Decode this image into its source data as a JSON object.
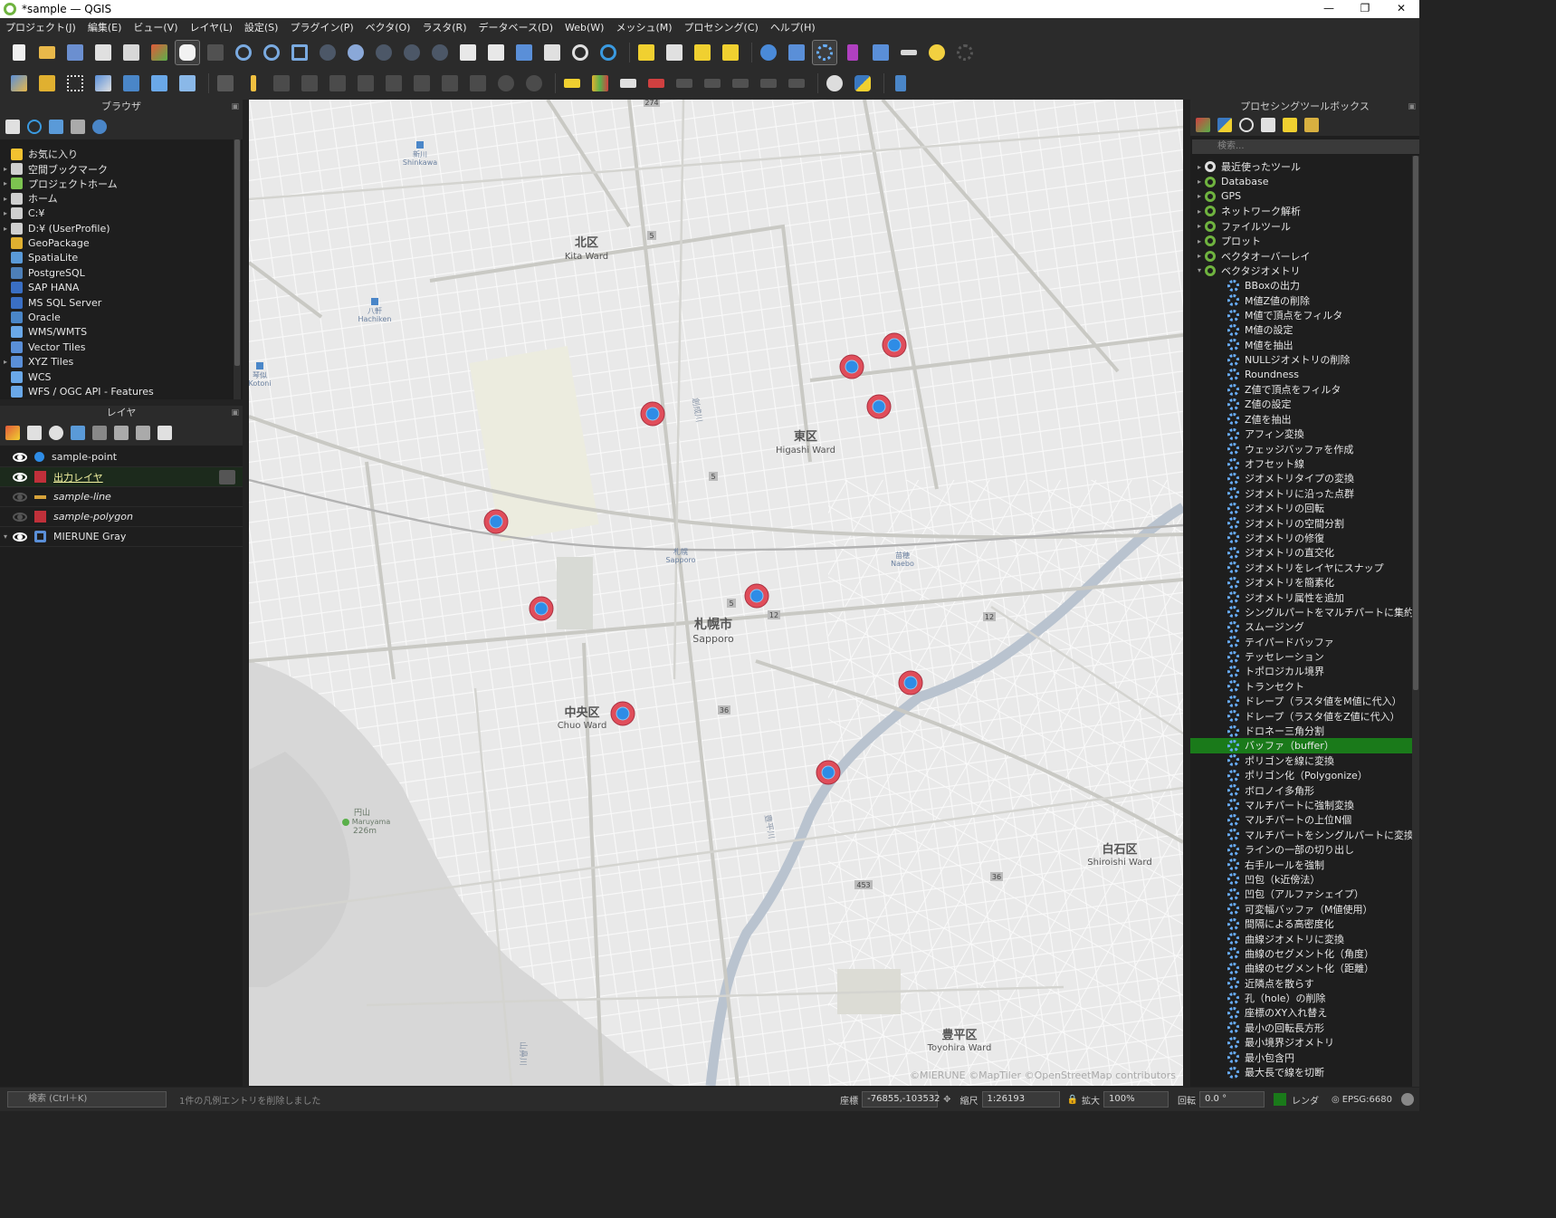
{
  "window": {
    "title": "*sample — QGIS",
    "controls": [
      "—",
      "❐",
      "✕"
    ]
  },
  "menu": [
    "プロジェクト(J)",
    "編集(E)",
    "ビュー(V)",
    "レイヤ(L)",
    "設定(S)",
    "プラグイン(P)",
    "ベクタ(O)",
    "ラスタ(R)",
    "データベース(D)",
    "Web(W)",
    "メッシュ(M)",
    "プロセシング(C)",
    "ヘルプ(H)"
  ],
  "browser": {
    "title": "ブラウザ",
    "items": [
      {
        "label": "お気に入り",
        "icon": "star-icon",
        "color": "#f2c230",
        "arrow": ""
      },
      {
        "label": "空間ブックマーク",
        "icon": "bookmark-icon",
        "color": "#cfcfcf",
        "arrow": "▸"
      },
      {
        "label": "プロジェクトホーム",
        "icon": "project-home-icon",
        "color": "#7cc350",
        "arrow": "▸"
      },
      {
        "label": "ホーム",
        "icon": "home-folder-icon",
        "color": "#cfcfcf",
        "arrow": "▸"
      },
      {
        "label": "C:¥",
        "icon": "drive-icon",
        "color": "#cfcfcf",
        "arrow": "▸"
      },
      {
        "label": "D:¥ (UserProfile)",
        "icon": "drive-icon",
        "color": "#cfcfcf",
        "arrow": "▸"
      },
      {
        "label": "GeoPackage",
        "icon": "geopackage-icon",
        "color": "#e0b030",
        "arrow": ""
      },
      {
        "label": "SpatiaLite",
        "icon": "spatialite-icon",
        "color": "#5a9ad8",
        "arrow": ""
      },
      {
        "label": "PostgreSQL",
        "icon": "postgresql-icon",
        "color": "#4d7fb8",
        "arrow": ""
      },
      {
        "label": "SAP HANA",
        "icon": "sap-hana-icon",
        "color": "#3a6fc4",
        "arrow": ""
      },
      {
        "label": "MS SQL Server",
        "icon": "mssql-icon",
        "color": "#3a6fc4",
        "arrow": ""
      },
      {
        "label": "Oracle",
        "icon": "oracle-icon",
        "color": "#4a86c8",
        "arrow": ""
      },
      {
        "label": "WMS/WMTS",
        "icon": "globe-icon",
        "color": "#6aa8e8",
        "arrow": ""
      },
      {
        "label": "Vector Tiles",
        "icon": "grid-icon",
        "color": "#5a8fd8",
        "arrow": ""
      },
      {
        "label": "XYZ Tiles",
        "icon": "grid-icon",
        "color": "#5a8fd8",
        "arrow": "▸"
      },
      {
        "label": "WCS",
        "icon": "globe-icon",
        "color": "#6aa8e8",
        "arrow": ""
      },
      {
        "label": "WFS / OGC API - Features",
        "icon": "globe-icon",
        "color": "#6aa8e8",
        "arrow": ""
      }
    ]
  },
  "layers": {
    "title": "レイヤ",
    "items": [
      {
        "label": "sample-point",
        "visible": true,
        "symbol": "point",
        "color": "#2e8ce6",
        "italic": false,
        "arrow": ""
      },
      {
        "label": "出力レイヤ",
        "visible": true,
        "symbol": "square",
        "color": "#c0303a",
        "italic": false,
        "arrow": "",
        "selected": true
      },
      {
        "label": "sample-line",
        "visible": false,
        "symbol": "line",
        "color": "#d6a23a",
        "italic": true,
        "arrow": ""
      },
      {
        "label": "sample-polygon",
        "visible": false,
        "symbol": "square",
        "color": "#c0303a",
        "italic": true,
        "arrow": ""
      },
      {
        "label": "MIERUNE Gray",
        "visible": true,
        "symbol": "tiles",
        "color": "#5a8fd8",
        "italic": false,
        "arrow": "▾"
      }
    ]
  },
  "processing": {
    "title": "プロセシングツールボックス",
    "search_placeholder": "検索...",
    "groups": [
      {
        "label": "最近使ったツール",
        "arrow": "▸",
        "icon": "clock-icon"
      },
      {
        "label": "Database",
        "arrow": "▸",
        "icon": "qgis-icon"
      },
      {
        "label": "GPS",
        "arrow": "▸",
        "icon": "qgis-icon"
      },
      {
        "label": "ネットワーク解析",
        "arrow": "▸",
        "icon": "qgis-icon"
      },
      {
        "label": "ファイルツール",
        "arrow": "▸",
        "icon": "qgis-icon"
      },
      {
        "label": "プロット",
        "arrow": "▸",
        "icon": "qgis-icon"
      },
      {
        "label": "ベクタオーバーレイ",
        "arrow": "▸",
        "icon": "qgis-icon"
      },
      {
        "label": "ベクタジオメトリ",
        "arrow": "▾",
        "icon": "qgis-icon"
      }
    ],
    "tools": [
      "BBoxの出力",
      "M値Z値の削除",
      "M値で頂点をフィルタ",
      "M値の設定",
      "M値を抽出",
      "NULLジオメトリの削除",
      "Roundness",
      "Z値で頂点をフィルタ",
      "Z値の設定",
      "Z値を抽出",
      "アフィン変換",
      "ウェッジバッファを作成",
      "オフセット線",
      "ジオメトリタイプの変換",
      "ジオメトリに沿った点群",
      "ジオメトリの回転",
      "ジオメトリの空間分割",
      "ジオメトリの修復",
      "ジオメトリの直交化",
      "ジオメトリをレイヤにスナップ",
      "ジオメトリを簡素化",
      "ジオメトリ属性を追加",
      "シングルパートをマルチパートに集約",
      "スムージング",
      "テイパードバッファ",
      "テッセレーション",
      "トポロジカル境界",
      "トランセクト",
      "ドレープ（ラスタ値をM値に代入）",
      "ドレープ（ラスタ値をZ値に代入）",
      "ドロネー三角分割",
      "バッファ（buffer）",
      "ポリゴンを線に変換",
      "ポリゴン化（Polygonize）",
      "ボロノイ多角形",
      "マルチパートに強制変換",
      "マルチパートの上位N個",
      "マルチパートをシングルパートに変換",
      "ラインの一部の切り出し",
      "右手ルールを強制",
      "凹包（k近傍法）",
      "凹包（アルファシェイプ）",
      "可変幅バッファ（M値使用）",
      "間隔による高密度化",
      "曲線ジオメトリに変換",
      "曲線のセグメント化（角度）",
      "曲線のセグメント化（距離）",
      "近隣点を散らす",
      "孔（hole）の削除",
      "座標のXY入れ替え",
      "最小の回転長方形",
      "最小境界ジオメトリ",
      "最小包含円",
      "最大長で線を切断"
    ],
    "highlighted": "バッファ（buffer）"
  },
  "map": {
    "labels": [
      {
        "text": "北区",
        "sub": "Kita Ward"
      },
      {
        "text": "東区",
        "sub": "Higashi Ward"
      },
      {
        "text": "札幌市",
        "sub": "Sapporo"
      },
      {
        "text": "中央区",
        "sub": "Chuo Ward"
      },
      {
        "text": "白石区",
        "sub": "Shiroishi Ward"
      },
      {
        "text": "豊平区",
        "sub": "Toyohira Ward"
      }
    ],
    "stations": [
      {
        "text": "新川",
        "sub": "Shinkawa"
      },
      {
        "text": "八軒",
        "sub": "Hachiken"
      },
      {
        "text": "琴似",
        "sub": "Kotoni"
      },
      {
        "text": "札幌",
        "sub": "Sapporo"
      },
      {
        "text": "苗穂",
        "sub": "Naebo"
      }
    ],
    "mountain": {
      "text": "円山",
      "sub": "Maruyama",
      "elev": "226m"
    },
    "river_labels": [
      "創成川",
      "豊平川",
      "山鼻川"
    ],
    "route_shields": [
      "274",
      "5",
      "5",
      "5",
      "12",
      "12",
      "36",
      "36",
      "453"
    ],
    "points_count": 11,
    "attribution": "©MIERUNE ©MapTiler ©OpenStreetMap contributors"
  },
  "status": {
    "search_placeholder": "検索 (Ctrl＋K)",
    "message": "1件の凡例エントリを削除しました",
    "coord_label": "座標",
    "coord_value": "-76855,-103532",
    "scale_label": "縮尺",
    "scale_value": "1:26193",
    "magnifier_label": "拡大",
    "magnifier_value": "100%",
    "rotation_label": "回転",
    "rotation_value": "0.0 °",
    "render_label": "レンダ",
    "crs": "EPSG:6680"
  },
  "colors": {
    "accent_green": "#1a7a1a",
    "point_fill": "#2e8ce6",
    "buffer_fill": "#e04d5a"
  }
}
